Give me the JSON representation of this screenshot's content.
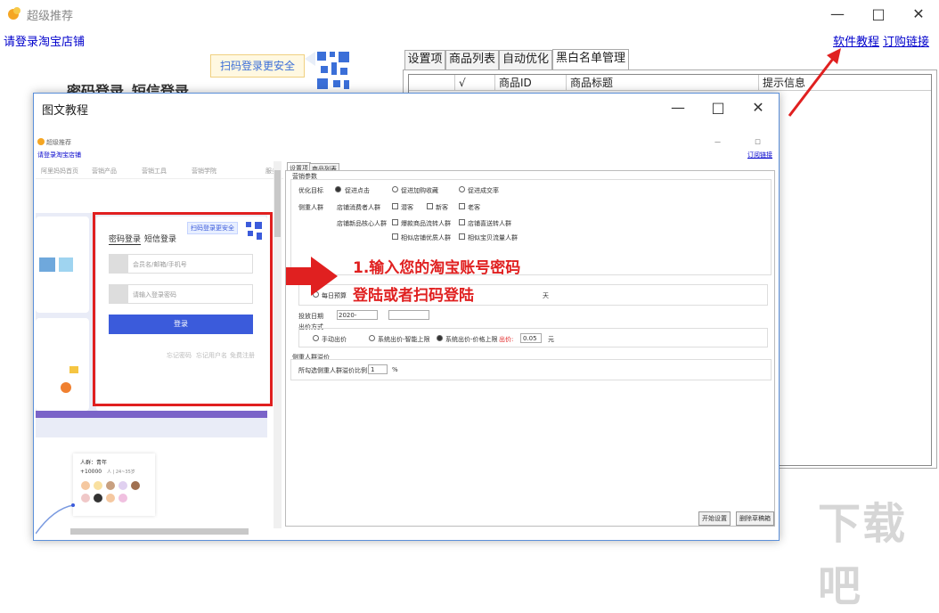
{
  "main_window": {
    "title": "超级推荐",
    "login_link": "请登录淘宝店铺",
    "tutorial_link": "软件教程",
    "order_link": "订购链接",
    "qr_tip": "扫码登录更安全",
    "login_tabs": [
      "密码登录",
      "短信登录"
    ],
    "tabs": [
      "设置项",
      "商品列表",
      "自动优化",
      "黑白名单管理"
    ],
    "table_headers": [
      "",
      "√",
      "商品ID",
      "商品标题",
      "提示信息"
    ]
  },
  "tutorial_window": {
    "title": "图文教程",
    "annotation_line1": "1.输入您的淘宝账号密码",
    "annotation_line2": "登陆或者扫码登陆",
    "shot": {
      "title": "超级推荐",
      "login_link": "请登录淘宝店铺",
      "tutorial_link": "订阅链接",
      "nav": [
        "阿里妈妈首页",
        "营销产品",
        "营销工具",
        "营销学院",
        "服务"
      ],
      "qr_tip": "扫码登录更安全",
      "login_tabs": [
        "密码登录",
        "短信登录"
      ],
      "user_placeholder": "会员名/邮箱/手机号",
      "pass_placeholder": "请输入登录密码",
      "login_btn": "登录",
      "footer_links": [
        "忘记密码",
        "忘记用户名",
        "免费注册"
      ],
      "crowd_label": "人群：青年",
      "crowd_count": "+10000",
      "crowd_range": "人 | 24~35岁",
      "tabs": [
        "设置项",
        "商品列表"
      ],
      "group_title": "营销参数",
      "opt_target_label": "优化目标",
      "opt_targets": [
        "促进点击",
        "促进加购收藏",
        "促进成交率"
      ],
      "crowd_target_label": "侧重人群",
      "crowd_row1_label": "店铺消费者人群",
      "crowd_row1": [
        "潜客",
        "新客",
        "老客"
      ],
      "crowd_row2_label": "店铺新品核心人群",
      "crowd_row2": [
        "爆款商品流转人群",
        "店铺喜送转人群"
      ],
      "crowd_row3": [
        "相似店铺优质人群",
        "相似宝贝流量人群"
      ],
      "budget_option": "每日预算",
      "budget_unit": "天",
      "date_label": "投放日期",
      "date_value": "2020-",
      "bid_label": "出价方式",
      "bid_options": [
        "手动出价",
        "系统出价-智能上限",
        "系统出价-价格上限"
      ],
      "bid_price_label": "出价:",
      "bid_price_value": "0.05",
      "bid_price_unit": "元",
      "crowd_premium_title": "侧重人群溢价",
      "crowd_premium_label": "所勾选侧重人群溢价比例",
      "crowd_premium_value": "1",
      "crowd_premium_unit": "%",
      "start_btn": "开始设置",
      "delete_btn": "删除草稿箱"
    }
  },
  "watermark": "下载吧",
  "colors": {
    "accent_red": "#e02020",
    "link_blue": "#0000cc",
    "login_blue": "#3b5bdb"
  }
}
